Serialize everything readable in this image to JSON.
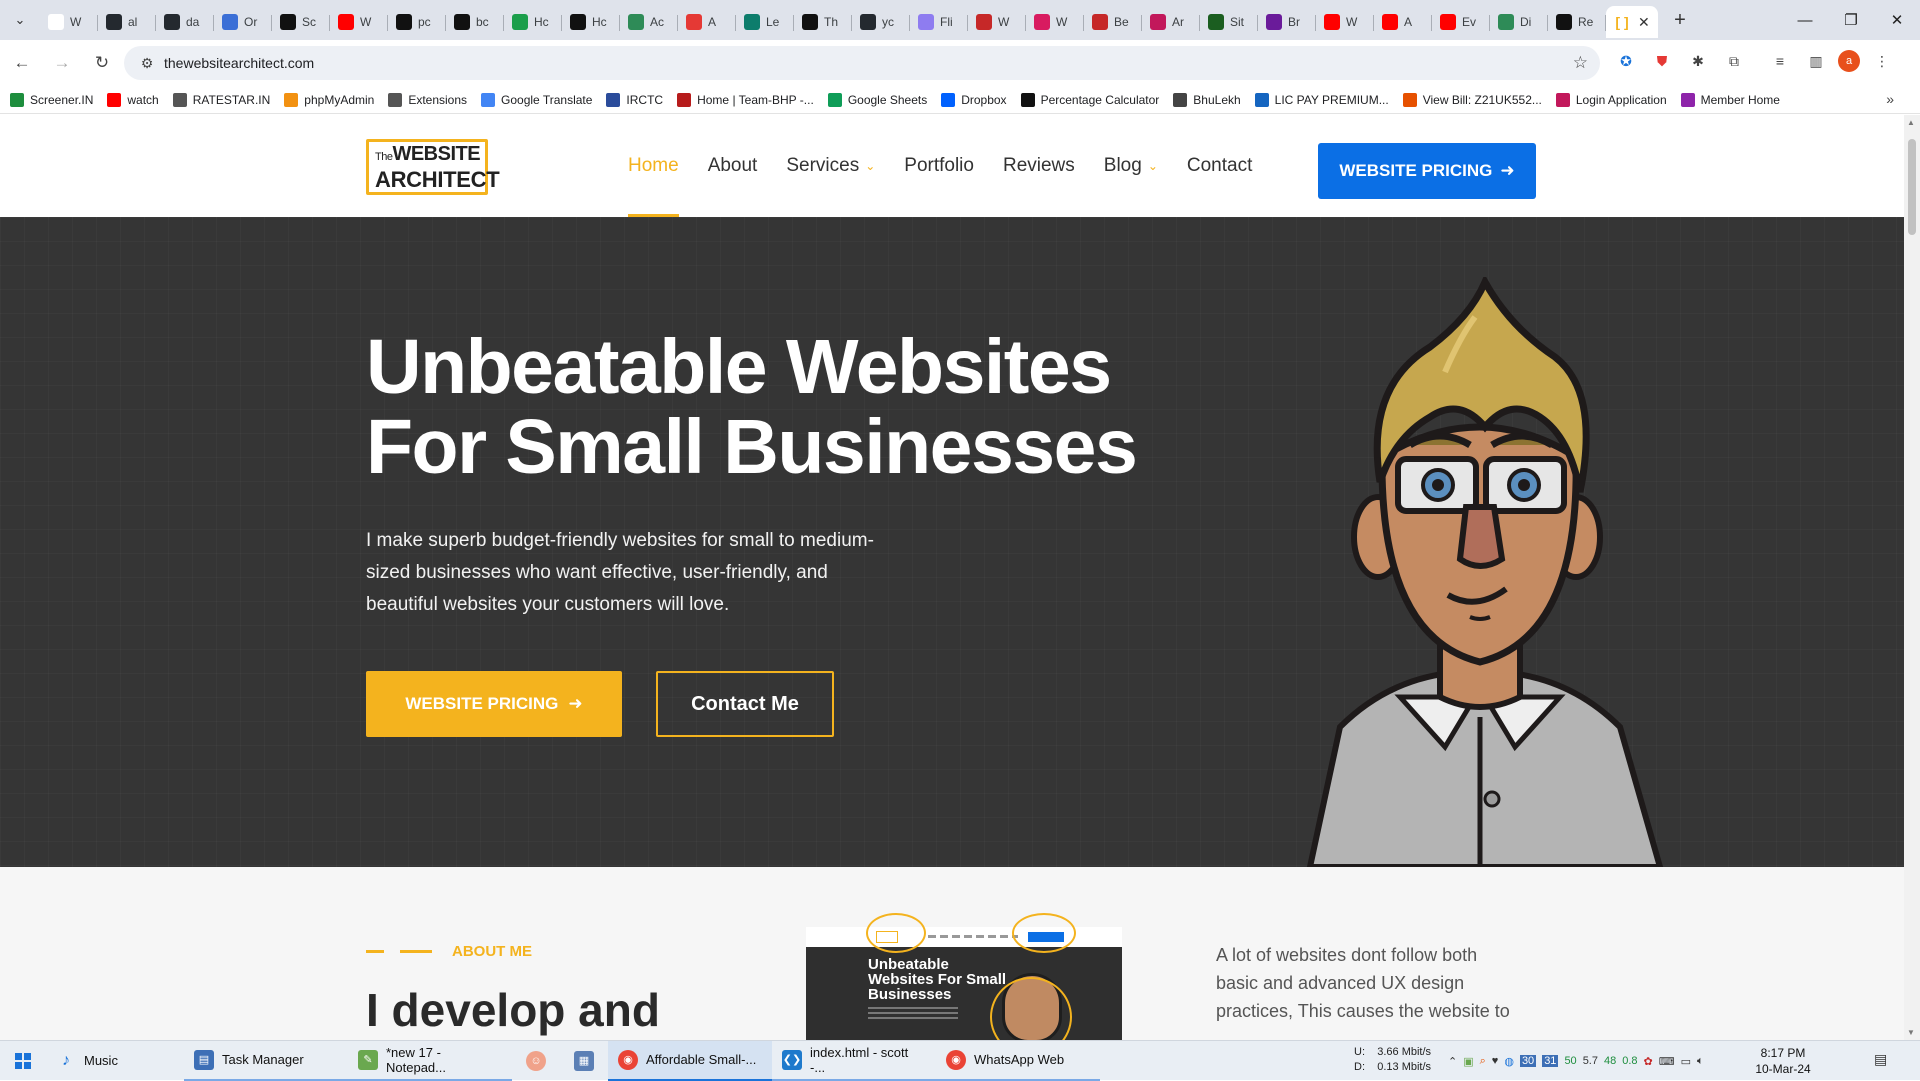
{
  "browser": {
    "tabs": [
      {
        "label": "W",
        "icon": "google-icon",
        "color": "#ffffff"
      },
      {
        "label": "al",
        "icon": "github-icon",
        "color": "#24292f"
      },
      {
        "label": "da",
        "icon": "github-icon",
        "color": "#24292f"
      },
      {
        "label": "Or",
        "icon": "generic-icon",
        "color": "#3b6fd6"
      },
      {
        "label": "Sc",
        "icon": "s-icon",
        "color": "#111111"
      },
      {
        "label": "W",
        "icon": "youtube-icon",
        "color": "#ff0000"
      },
      {
        "label": "pc",
        "icon": "medium-icon",
        "color": "#111111"
      },
      {
        "label": "bc",
        "icon": "medium-icon",
        "color": "#111111"
      },
      {
        "label": "Hc",
        "icon": "w-icon",
        "color": "#1b9e4b"
      },
      {
        "label": "Hc",
        "icon": "a-icon",
        "color": "#111111"
      },
      {
        "label": "Ac",
        "icon": "link-icon",
        "color": "#2e8b57"
      },
      {
        "label": "A",
        "icon": "star-icon",
        "color": "#e53935"
      },
      {
        "label": "Le",
        "icon": "leaf-icon",
        "color": "#0d7d6c"
      },
      {
        "label": "Th",
        "icon": "dev-icon",
        "color": "#111111"
      },
      {
        "label": "yc",
        "icon": "github-icon",
        "color": "#24292f"
      },
      {
        "label": "Fli",
        "icon": "circle-icon",
        "color": "#8e7cf0"
      },
      {
        "label": "W",
        "icon": "nn-icon",
        "color": "#c62828"
      },
      {
        "label": "W",
        "icon": "ring-icon",
        "color": "#d81b60"
      },
      {
        "label": "Be",
        "icon": "nn-icon",
        "color": "#c62828"
      },
      {
        "label": "Ar",
        "icon": "butterfly-icon",
        "color": "#c2185b"
      },
      {
        "label": "Sit",
        "icon": "n-icon",
        "color": "#1b5e20"
      },
      {
        "label": "Br",
        "icon": "b-icon",
        "color": "#6a1b9a"
      },
      {
        "label": "W",
        "icon": "youtube-icon",
        "color": "#ff0000"
      },
      {
        "label": "A",
        "icon": "youtube-icon",
        "color": "#ff0000"
      },
      {
        "label": "Ev",
        "icon": "youtube-icon",
        "color": "#ff0000"
      },
      {
        "label": "Di",
        "icon": "link-icon",
        "color": "#2e8b57"
      },
      {
        "label": "Re",
        "icon": "medium-icon",
        "color": "#111111"
      }
    ],
    "active_tab_icon": "bracket-icon",
    "url": "thewebsitearchitect.com",
    "bookmarks": [
      {
        "label": "Screener.IN",
        "color": "#1e8e3e"
      },
      {
        "label": "watch",
        "color": "#ff0000"
      },
      {
        "label": "RATESTAR.IN",
        "color": "#555555"
      },
      {
        "label": "phpMyAdmin",
        "color": "#f29111"
      },
      {
        "label": "Extensions",
        "color": "#555555"
      },
      {
        "label": "Google Translate",
        "color": "#4285f4"
      },
      {
        "label": "IRCTC",
        "color": "#2b4c9b"
      },
      {
        "label": "Home | Team-BHP -...",
        "color": "#b71c1c"
      },
      {
        "label": "Google Sheets",
        "color": "#0f9d58"
      },
      {
        "label": "Dropbox",
        "color": "#0061fe"
      },
      {
        "label": "Percentage Calculator",
        "color": "#111111"
      },
      {
        "label": "BhuLekh",
        "color": "#444444"
      },
      {
        "label": "LIC PAY PREMIUM...",
        "color": "#1565c0"
      },
      {
        "label": "View Bill: Z21UK552...",
        "color": "#e65100"
      },
      {
        "label": "Login Application",
        "color": "#c2185b"
      },
      {
        "label": "Member Home",
        "color": "#8e24aa"
      }
    ]
  },
  "site": {
    "logo": {
      "the": "The",
      "line1": "WEBSITE",
      "line2": "ARCHITECT"
    },
    "nav": [
      {
        "label": "Home",
        "active": true,
        "dropdown": false
      },
      {
        "label": "About",
        "active": false,
        "dropdown": false
      },
      {
        "label": "Services",
        "active": false,
        "dropdown": true
      },
      {
        "label": "Portfolio",
        "active": false,
        "dropdown": false
      },
      {
        "label": "Reviews",
        "active": false,
        "dropdown": false
      },
      {
        "label": "Blog",
        "active": false,
        "dropdown": true
      },
      {
        "label": "Contact",
        "active": false,
        "dropdown": false
      }
    ],
    "header_cta": "WEBSITE PRICING",
    "hero": {
      "title_line1": "Unbeatable Websites",
      "title_line2": "For Small Businesses",
      "subtitle": "I make superb budget-friendly websites for small to medium-sized businesses who want effective, user-friendly, and beautiful websites your customers will love.",
      "primary_button": "WEBSITE PRICING",
      "secondary_button": "Contact Me"
    },
    "about": {
      "kicker": "ABOUT ME",
      "heading": "I develop and",
      "preview_title": "Unbeatable Websites For Small Businesses",
      "text": "A lot of websites dont follow both basic and advanced UX design practices, This causes the website to"
    },
    "colors": {
      "accent": "#f4b31e",
      "brand_blue": "#0b6fe5",
      "hero_bg": "#353535"
    }
  },
  "taskbar": {
    "apps": [
      {
        "label": "Music",
        "icon": "music-icon",
        "color": "#1a73d9"
      },
      {
        "label": "Task Manager",
        "icon": "task-manager-icon",
        "color": "#3d6fb6"
      },
      {
        "label": "*new 17 - Notepad...",
        "icon": "notepadpp-icon",
        "color": "#6aa84f"
      },
      {
        "label": "Affordable Small-...",
        "icon": "chrome-icon",
        "color": "#ea4335"
      },
      {
        "label": "index.html - scott -...",
        "icon": "vscode-icon",
        "color": "#1f7acc"
      },
      {
        "label": "WhatsApp Web",
        "icon": "chrome-icon",
        "color": "#ea4335"
      }
    ],
    "network": {
      "up": "3.66 Mbit/s",
      "down": "0.13 Mbit/s",
      "up_label": "U:",
      "down_label": "D:"
    },
    "tray_numbers": [
      "30",
      "31",
      "50",
      "5.7",
      "48",
      "0.8"
    ],
    "time": "8:17 PM",
    "date": "10-Mar-24"
  }
}
